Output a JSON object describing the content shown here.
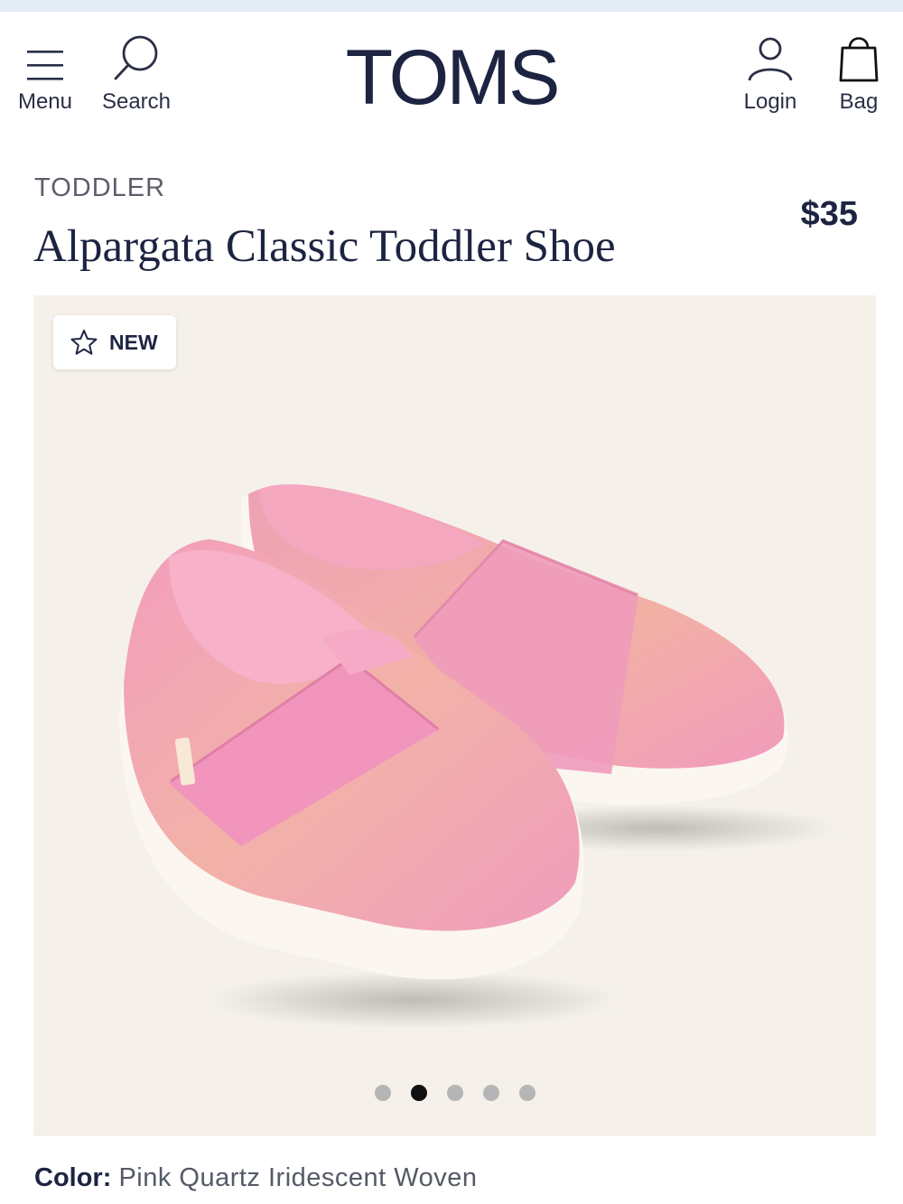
{
  "header": {
    "menu_label": "Menu",
    "search_label": "Search",
    "logo": "TOMS",
    "login_label": "Login",
    "bag_label": "Bag"
  },
  "product": {
    "category": "TODDLER",
    "title": "Alpargata Classic Toddler Shoe",
    "price": "$35",
    "badge": "NEW",
    "color_label": "Color:",
    "color_value": "Pink Quartz Iridescent Woven"
  },
  "gallery": {
    "image_count": 5,
    "active_index": 1
  },
  "colors": {
    "brand_navy": "#1d2442",
    "image_bg": "#f5f1ea",
    "shoe_pink": "#f0a7c4",
    "dot_active": "#111111",
    "dot_inactive": "#b5b5b5"
  },
  "icons": [
    "hamburger-icon",
    "search-icon",
    "user-icon",
    "bag-icon",
    "star-icon"
  ]
}
